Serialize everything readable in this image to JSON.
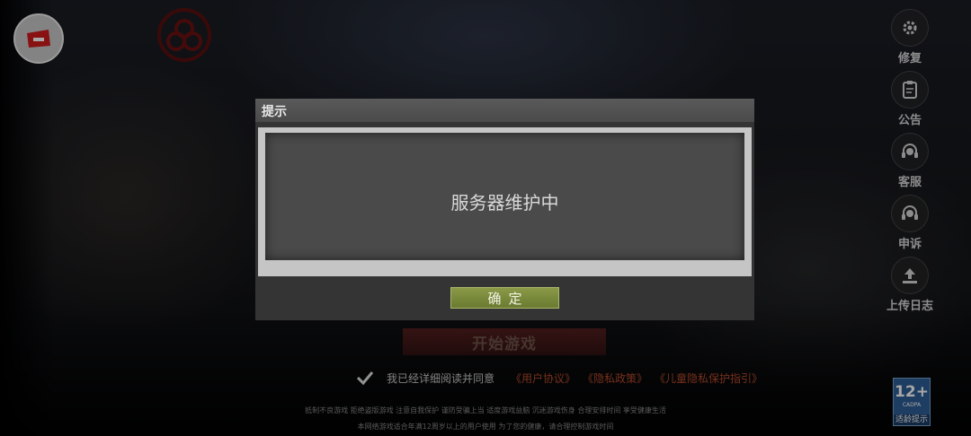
{
  "side_menu": [
    {
      "label": "修复",
      "icon": "gear-icon"
    },
    {
      "label": "公告",
      "icon": "clipboard-icon"
    },
    {
      "label": "客服",
      "icon": "headset-icon"
    },
    {
      "label": "申诉",
      "icon": "headset-icon"
    },
    {
      "label": "上传日志",
      "icon": "upload-icon"
    }
  ],
  "main": {
    "start_label": "开始游戏",
    "agree_text": "我已经详细阅读并同意",
    "links": [
      "《用户协议》",
      "《隐私政策》",
      "《儿童隐私保护指引》"
    ],
    "notice_line1": "抵制不良游戏 拒绝盗版游戏 注意自我保护 谨防受骗上当 适度游戏益脑 沉迷游戏伤身 合理安排时间 享受健康生活",
    "notice_line2": "本网络游戏适合年满12周岁以上的用户使用    为了您的健康，请合理控制游戏时间"
  },
  "age_rating": {
    "rating": "12+",
    "org": "CADPA",
    "tip": "适龄提示"
  },
  "dialog": {
    "title": "提示",
    "message": "服务器维护中",
    "ok_label": "确定"
  },
  "colors": {
    "accent_red": "#b64a2c",
    "ok_green": "#7a8a3c",
    "dialog_bg": "#343434"
  }
}
